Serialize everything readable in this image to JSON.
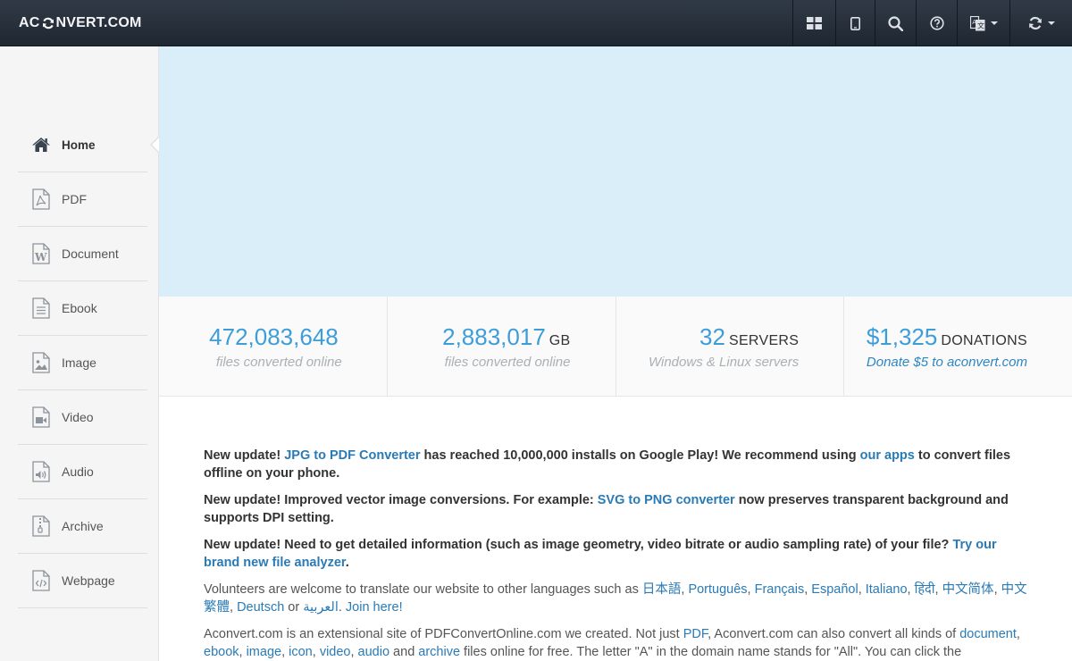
{
  "brand": {
    "prefix": "AC",
    "suffix": "NVERT.COM"
  },
  "navbar": {
    "buttons": [
      {
        "name": "grid-view-button",
        "icon": "grid-icon"
      },
      {
        "name": "mobile-button",
        "icon": "tablet-icon"
      },
      {
        "name": "search-button",
        "icon": "search-icon"
      },
      {
        "name": "help-button",
        "icon": "question-circle-icon"
      },
      {
        "name": "language-button",
        "icon": "translate-icon"
      },
      {
        "name": "convert-menu-button",
        "icon": "refresh-icon"
      }
    ]
  },
  "sidebar": {
    "items": [
      {
        "label": "Home",
        "icon": "home-icon",
        "active": true
      },
      {
        "label": "PDF",
        "icon": "pdf-file-icon"
      },
      {
        "label": "Document",
        "icon": "word-file-icon"
      },
      {
        "label": "Ebook",
        "icon": "ebook-file-icon"
      },
      {
        "label": "Image",
        "icon": "image-file-icon"
      },
      {
        "label": "Video",
        "icon": "video-file-icon"
      },
      {
        "label": "Audio",
        "icon": "audio-file-icon"
      },
      {
        "label": "Archive",
        "icon": "archive-file-icon"
      },
      {
        "label": "Webpage",
        "icon": "code-file-icon"
      }
    ]
  },
  "stats": [
    {
      "number": "472,083,648",
      "unit": "",
      "sub": "files converted online"
    },
    {
      "number": "2,883,017",
      "unit": "GB",
      "sub": "files converted online"
    },
    {
      "number": "32",
      "unit": "SERVERS",
      "sub": "Windows & Linux servers"
    },
    {
      "number": "$1,325",
      "unit": "DONATIONS",
      "sub": "Donate $5 to aconvert.com"
    }
  ],
  "content": {
    "p1": {
      "a": "New update! ",
      "link1": "JPG to PDF Converter",
      "b": " has reached 10,000,000 installs on Google Play! We recommend using ",
      "link2": "our apps",
      "c": " to convert files offline on your phone."
    },
    "p2": {
      "a": "New update! Improved vector image conversions. For example: ",
      "link1": "SVG to PNG converter",
      "b": " now preserves transparent background and supports DPI setting."
    },
    "p3": {
      "a": "New update! Need to get detailed information (such as image geometry, video bitrate or audio sampling rate) of your file? ",
      "link1": "Try our brand new file analyzer",
      "b": "."
    },
    "p4": {
      "a": "Volunteers are welcome to translate our website to other languages such as ",
      "langs": [
        "日本語",
        "Português",
        "Français",
        "Español",
        "Italiano",
        "हिंदी",
        "中文简体",
        "中文繁體",
        "Deutsch"
      ],
      "or": " or ",
      "arabic": "العربية",
      "join": "Join here!"
    },
    "p5": {
      "a": "Aconvert.com is an extensional site of PDFConvertOnline.com we created. Not just ",
      "pdf": "PDF",
      "b": ", Aconvert.com can also convert all kinds of ",
      "links": [
        "document",
        "ebook",
        "image",
        "icon",
        "video",
        "audio"
      ],
      "and": " and ",
      "archive": "archive",
      "c": " files online for free. The letter \"A\" in the domain name stands for \"All\". You can click the"
    }
  },
  "colors": {
    "accent": "#3d9dd9",
    "link": "#2a7ab5",
    "navbar": "#28313c",
    "banner": "#d9eef8"
  }
}
